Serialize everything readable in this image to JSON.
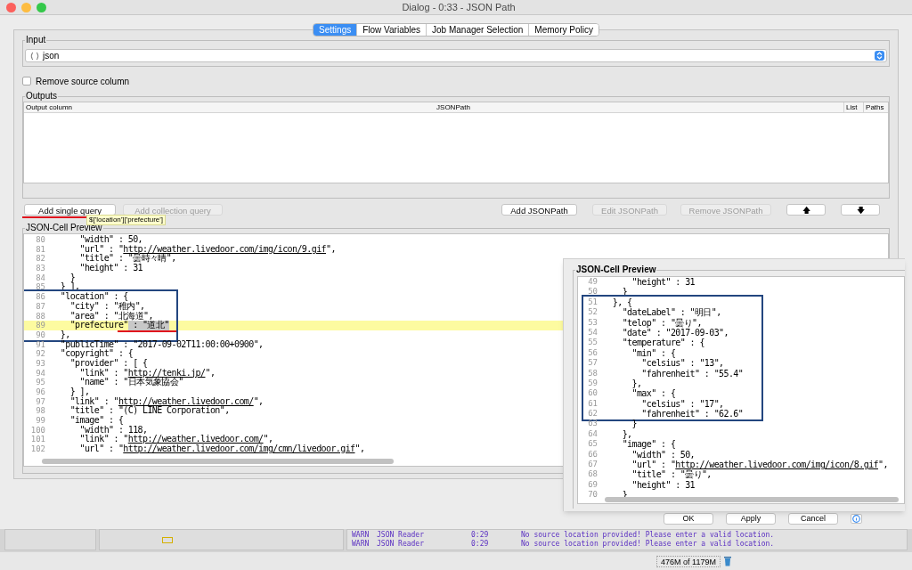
{
  "window": {
    "title": "Dialog - 0:33 - JSON Path"
  },
  "tabs": [
    {
      "label": "Settings",
      "selected": true
    },
    {
      "label": "Flow Variables",
      "selected": false
    },
    {
      "label": "Job Manager Selection",
      "selected": false
    },
    {
      "label": "Memory Policy",
      "selected": false
    }
  ],
  "input": {
    "label": "Input",
    "value": "json"
  },
  "remove_source_column": {
    "label": "Remove source column",
    "checked": false
  },
  "outputs": {
    "label": "Outputs",
    "columns": [
      "Output column",
      "JSONPath",
      "List",
      "Paths"
    ]
  },
  "query_buttons": [
    {
      "label": "Add single query",
      "disabled": false,
      "underlined": true
    },
    {
      "label": "Add collection query",
      "disabled": true,
      "underlined": false
    }
  ],
  "path_buttons": [
    {
      "label": "Add JSONPath",
      "disabled": false
    },
    {
      "label": "Edit JSONPath",
      "disabled": true
    },
    {
      "label": "Remove JSONPath",
      "disabled": true
    }
  ],
  "move_buttons": [
    {
      "label": "🡅"
    },
    {
      "label": "🡇"
    }
  ],
  "tooltip": "$['location']['prefecture']",
  "preview": {
    "label": "JSON-Cell Preview",
    "blocks": [
      {
        "framed": false,
        "lines": [
          {
            "n": "80",
            "code": "      \"width\" : 50,"
          },
          {
            "n": "81",
            "code": "      \"url\" : \"",
            "link": "http://weather.livedoor.com/img/icon/9.gif",
            "after": "\","
          },
          {
            "n": "82",
            "code": "      \"title\" : \"曇時々晴\","
          },
          {
            "n": "83",
            "code": "      \"height\" : 31"
          },
          {
            "n": "84",
            "code": "    }"
          },
          {
            "n": "85",
            "code": "  } ],"
          }
        ]
      },
      {
        "framed": true,
        "lines": [
          {
            "n": "86",
            "code": "  \"location\" : {"
          },
          {
            "n": "87",
            "code": "    \"city\" : \"稚内\","
          },
          {
            "n": "88",
            "code": "    \"area\" : \"北海道\","
          },
          {
            "n": "89",
            "code": "    \"prefecture\"",
            "selection": " : \"道北\"",
            "current": true,
            "underlined": true
          },
          {
            "n": "90",
            "code": "  },"
          }
        ]
      },
      {
        "framed": false,
        "lines": [
          {
            "n": "91",
            "code": "  \"publicTime\" : \"2017-09-02T11:00:00+0900\","
          },
          {
            "n": "92",
            "code": "  \"copyright\" : {"
          },
          {
            "n": "93",
            "code": "    \"provider\" : [ {"
          },
          {
            "n": "94",
            "code": "      \"link\" : \"",
            "link": "http://tenki.jp/",
            "after": "\","
          },
          {
            "n": "95",
            "code": "      \"name\" : \"日本気象協会\""
          },
          {
            "n": "96",
            "code": "    } ],"
          },
          {
            "n": "97",
            "code": "    \"link\" : \"",
            "link": "http://weather.livedoor.com/",
            "after": "\","
          },
          {
            "n": "98",
            "code": "    \"title\" : \"(C) LINE Corporation\","
          },
          {
            "n": "99",
            "code": "    \"image\" : {"
          },
          {
            "n": "100",
            "code": "      \"width\" : 118,"
          },
          {
            "n": "101",
            "code": "      \"link\" : \"",
            "link": "http://weather.livedoor.com/",
            "after": "\","
          },
          {
            "n": "102",
            "code": "      \"url\" : \"",
            "link": "http://weather.livedoor.com/img/cmn/livedoor.gif",
            "after": "\","
          }
        ]
      }
    ]
  },
  "inset_preview": {
    "label": "JSON-Cell Preview",
    "blocks": [
      {
        "framed": false,
        "lines": [
          {
            "n": "49",
            "code": "      \"height\" : 31"
          },
          {
            "n": "50",
            "code": "    }"
          }
        ]
      },
      {
        "framed": true,
        "lines": [
          {
            "n": "51",
            "code": "  }, {"
          },
          {
            "n": "52",
            "code": "    \"dateLabel\" : \"明日\","
          },
          {
            "n": "53",
            "code": "    \"telop\" : \"曇り\","
          },
          {
            "n": "54",
            "code": "    \"date\" : \"2017-09-03\","
          },
          {
            "n": "55",
            "code": "    \"temperature\" : {"
          },
          {
            "n": "56",
            "code": "      \"min\" : {"
          },
          {
            "n": "57",
            "code": "        \"celsius\" : \"13\","
          },
          {
            "n": "58",
            "code": "        \"fahrenheit\" : \"55.4\""
          },
          {
            "n": "59",
            "code": "      },"
          },
          {
            "n": "60",
            "code": "      \"max\" : {"
          },
          {
            "n": "61",
            "code": "        \"celsius\" : \"17\","
          },
          {
            "n": "62",
            "code": "        \"fahrenheit\" : \"62.6\""
          }
        ]
      },
      {
        "framed": false,
        "lines": [
          {
            "n": "63",
            "code": "      }"
          },
          {
            "n": "64",
            "code": "    },"
          },
          {
            "n": "65",
            "code": "    \"image\" : {"
          },
          {
            "n": "66",
            "code": "      \"width\" : 50,"
          },
          {
            "n": "67",
            "code": "      \"url\" : \"",
            "link": "http://weather.livedoor.com/img/icon/8.gif",
            "after": "\","
          },
          {
            "n": "68",
            "code": "      \"title\" : \"曇り\","
          },
          {
            "n": "69",
            "code": "      \"height\" : 31"
          },
          {
            "n": "70",
            "code": "    }"
          }
        ]
      }
    ]
  },
  "dialog_buttons": [
    "OK",
    "Apply",
    "Cancel"
  ],
  "console": [
    {
      "level": "WARN",
      "source": "JSON Reader",
      "time": "0:29",
      "message": "No source location provided! Please enter a valid location."
    },
    {
      "level": "WARN",
      "source": "JSON Reader",
      "time": "0:29",
      "message": "No source location provided! Please enter a valid location."
    }
  ],
  "memory": "476M of 1179M"
}
